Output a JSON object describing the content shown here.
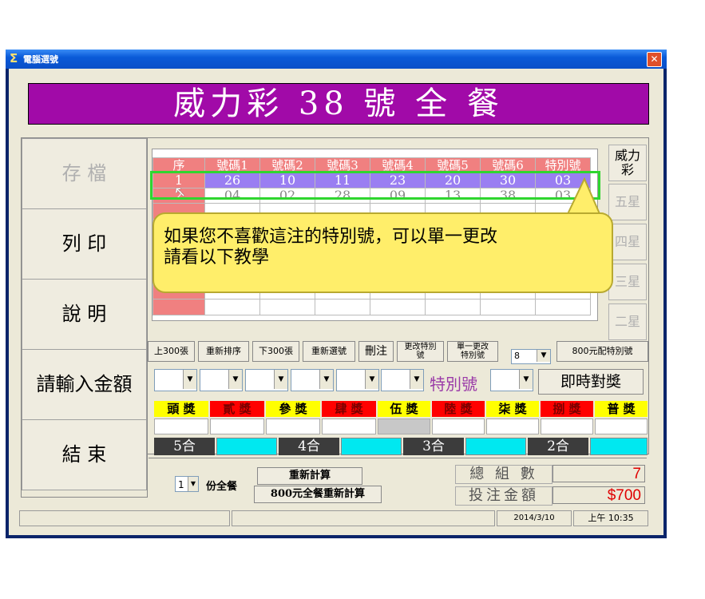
{
  "window": {
    "title": "電腦選號",
    "close": "✕"
  },
  "banner": "威力彩 38 號 全 餐",
  "left_buttons": [
    "存 檔",
    "列 印",
    "說 明",
    "請輸入金額",
    "結 束"
  ],
  "grid": {
    "headers": [
      "序",
      "號碼1",
      "號碼2",
      "號碼3",
      "號碼4",
      "號碼5",
      "號碼6",
      "特別號"
    ],
    "rows": [
      [
        "1",
        "26",
        "10",
        "11",
        "23",
        "20",
        "30",
        "03"
      ],
      [
        "2",
        "04",
        "02",
        "28",
        "09",
        "13",
        "38",
        "03"
      ]
    ]
  },
  "star_buttons": [
    "威力彩",
    "五星",
    "四星",
    "三星",
    "二星"
  ],
  "toolbar": {
    "up300": "上300張",
    "resort": "重新排序",
    "down300": "下300張",
    "reselect": "重新選號",
    "delete": "刪注",
    "change_special_1": "更改特別",
    "change_special_2": "號",
    "single_change_1": "單一更改",
    "single_change_2": "特別號",
    "count_value": "8",
    "config_800": "800元配特別號"
  },
  "special_label": "特別號",
  "check_button": "即時對獎",
  "prizes": [
    "頭 獎",
    "貳 獎",
    "參 獎",
    "肆 獎",
    "伍 獎",
    "陸 獎",
    "柒 獎",
    "捌 獎",
    "普 獎"
  ],
  "matches": [
    "5合",
    "4合",
    "3合",
    "2合"
  ],
  "bottom": {
    "fen_value": "1",
    "fen_label": "份全餐",
    "recalc": "重新計算",
    "recalc800": "800元全餐重新計算",
    "total_groups_label": "總 組 數",
    "total_groups_value": "7",
    "bet_amount_label": "投注金額",
    "bet_amount_value": "$700"
  },
  "status": {
    "date": "2014/3/10",
    "time": "上午 10:35"
  },
  "tooltip": {
    "line1": "如果您不喜歡這注的特別號，可以單一更改",
    "line2": "請看以下教學"
  }
}
